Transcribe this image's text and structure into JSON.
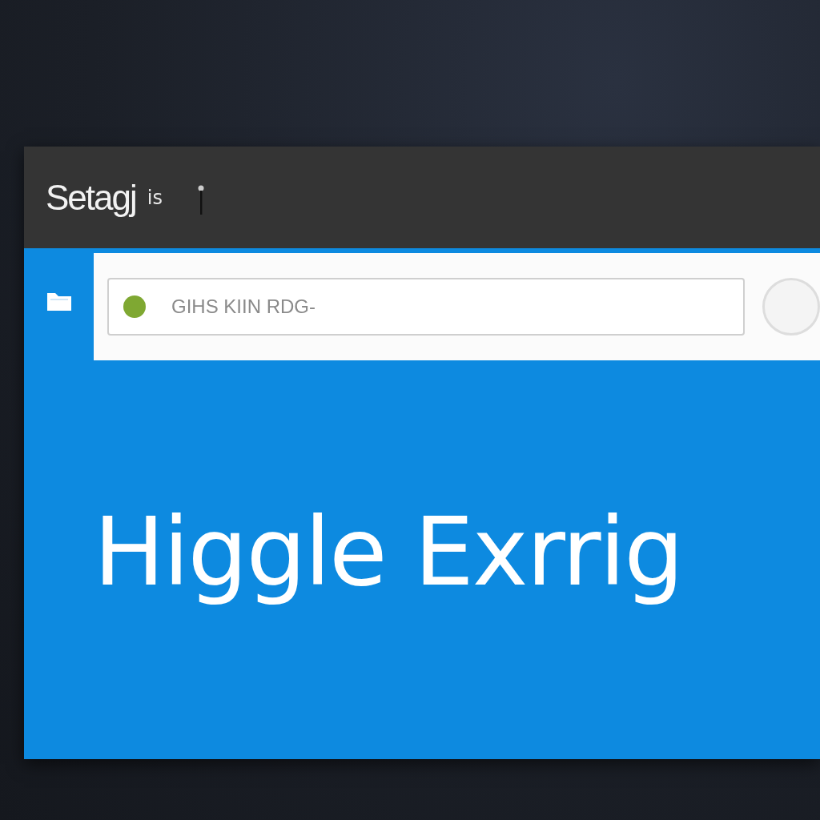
{
  "window": {
    "title": "Setagj",
    "title_suffix": "is"
  },
  "search": {
    "placeholder": "GIHS KIIN RDG-"
  },
  "hero": {
    "heading": "Higgle Exrrig"
  }
}
